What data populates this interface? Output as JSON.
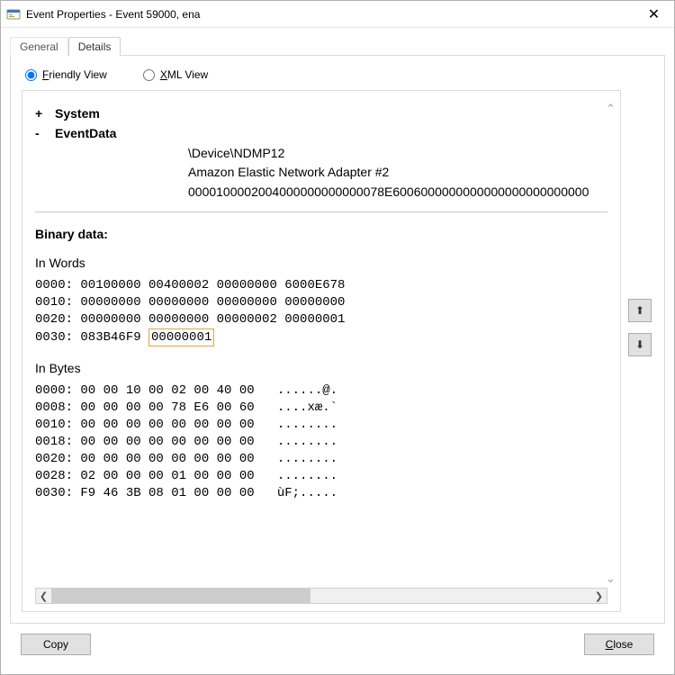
{
  "window": {
    "title": "Event Properties - Event 59000, ena"
  },
  "tabs": {
    "general": "General",
    "details": "Details",
    "active": "details"
  },
  "view_radios": {
    "friendly_prefix": "F",
    "friendly_rest": "riendly View",
    "xml_prefix": "X",
    "xml_rest": "ML View",
    "selected": "friendly"
  },
  "tree": {
    "system": {
      "expander": "+",
      "label": "System"
    },
    "eventdata": {
      "expander": "-",
      "label": "EventData"
    }
  },
  "event_values": {
    "device": "\\Device\\NDMP12",
    "adapter": "Amazon Elastic Network Adapter #2",
    "hexline": "0000100002004000000000000078E6006000000000000000000000000"
  },
  "binary": {
    "title": "Binary data:",
    "words_label": "In Words",
    "bytes_label": "In Bytes",
    "words_pre": "0000: 00100000 00400002 00000000 6000E678\n0010: 00000000 00000000 00000000 00000000\n0020: 00000000 00000000 00000002 00000001",
    "words_last_prefix": "0030: 083B46F9 ",
    "words_last_highlight": "00000001",
    "bytes": "0000: 00 00 10 00 02 00 40 00   ......@.\n0008: 00 00 00 00 78 E6 00 60   ....xæ.`\n0010: 00 00 00 00 00 00 00 00   ........\n0018: 00 00 00 00 00 00 00 00   ........\n0020: 00 00 00 00 00 00 00 00   ........\n0028: 02 00 00 00 01 00 00 00   ........\n0030: F9 46 3B 08 01 00 00 00   ùF;....."
  },
  "footer": {
    "copy": "Copy",
    "close_prefix": "C",
    "close_rest": "lose"
  },
  "icons": {
    "close_x": "✕",
    "up_arrow": "⬆",
    "down_arrow": "⬇",
    "caret_up": "⌃",
    "caret_down": "⌄",
    "scroll_left": "❮",
    "scroll_right": "❯"
  }
}
